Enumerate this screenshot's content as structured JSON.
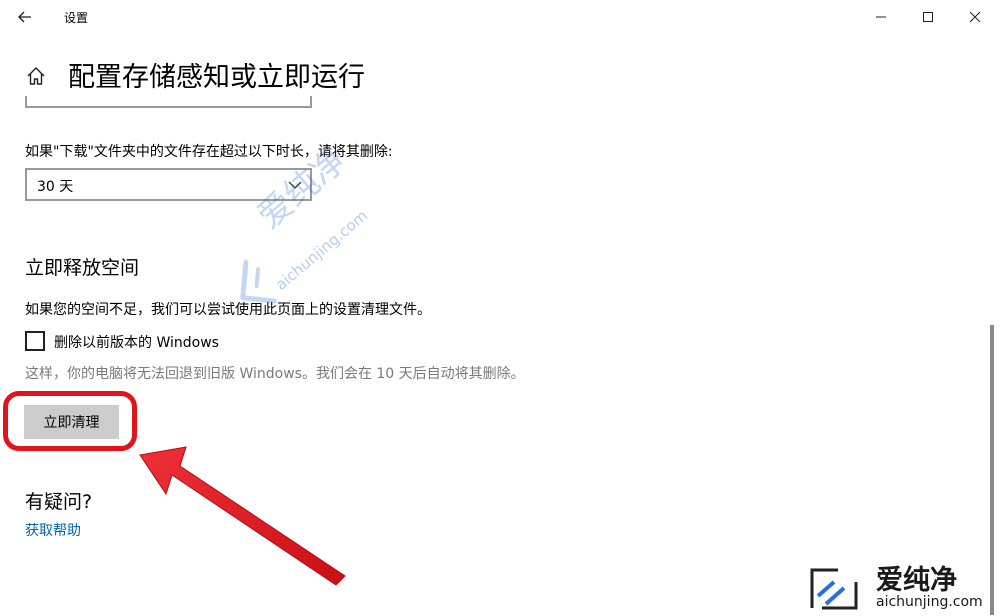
{
  "window": {
    "app_title": "设置",
    "back_icon": "arrow-left-icon",
    "controls": [
      "minimize-icon",
      "maximize-icon",
      "close-icon"
    ]
  },
  "header": {
    "home_icon": "home-icon",
    "title": "配置存储感知或立即运行"
  },
  "downloads": {
    "label": "如果\"下载\"文件夹中的文件存在超过以下时长，请将其删除:",
    "selected_value": "30 天"
  },
  "free_space": {
    "title": "立即释放空间",
    "description": "如果您的空间不足，我们可以尝试使用此页面上的设置清理文件。",
    "checkbox_label": "删除以前版本的 Windows",
    "checkbox_checked": false,
    "checkbox_note": "这样，你的电脑将无法回退到旧版 Windows。我们会在 10 天后自动将其删除。",
    "button_label": "立即清理"
  },
  "questions": {
    "title": "有疑问?",
    "help_link": "获取帮助"
  },
  "watermark": {
    "text_cn": "爱纯净",
    "text_url": "aichunjing.com",
    "color": "#2a6fd6"
  },
  "colors": {
    "highlight": "#e1141b",
    "link": "#0066b4",
    "button_bg": "#cccccc"
  }
}
